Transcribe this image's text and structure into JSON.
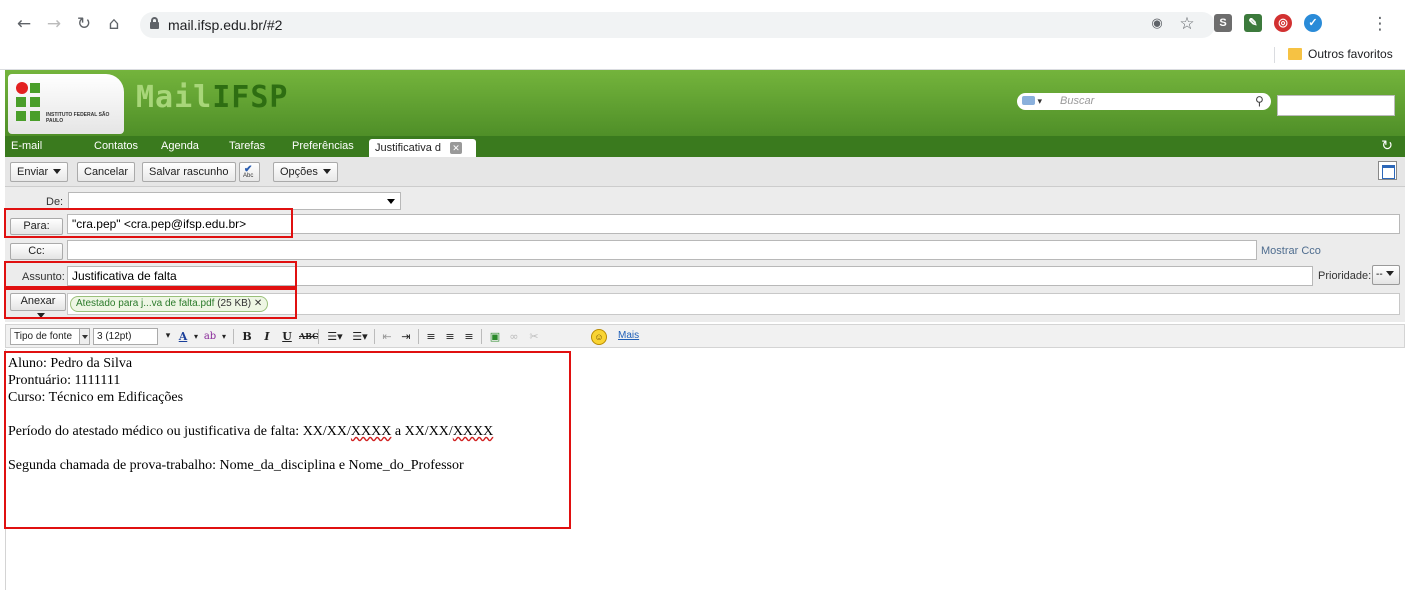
{
  "browser": {
    "url": "mail.ifsp.edu.br/#2",
    "bookmark_folder": "Outros favoritos"
  },
  "header": {
    "brand_prefix": "Mail",
    "brand_suffix": "IFSP",
    "logo_text": "INSTITUTO FEDERAL SÃO PAULO",
    "search_placeholder": "Buscar"
  },
  "app_tabs": {
    "items": [
      "E-mail",
      "Contatos",
      "Agenda",
      "Tarefas",
      "Preferências"
    ],
    "active": "Justificativa d"
  },
  "toolbar": {
    "send": "Enviar",
    "cancel": "Cancelar",
    "save_draft": "Salvar rascunho",
    "spell_check": "Abc",
    "options": "Opções"
  },
  "compose": {
    "from_label": "De:",
    "to_label": "Para:",
    "to_value": "\"cra.pep\" <cra.pep@ifsp.edu.br>",
    "cc_label": "Cc:",
    "show_bcc": "Mostrar Cco",
    "subject_label": "Assunto:",
    "subject_value": "Justificativa de falta",
    "priority_label": "Prioridade:",
    "priority_value": "--",
    "attach_label": "Anexar",
    "attachment_name": "Atestado para j...va de falta.pdf",
    "attachment_size": "(25 KB)"
  },
  "editor_toolbar": {
    "font_family": "Tipo de fonte",
    "font_size": "3 (12pt)",
    "more": "Mais"
  },
  "body": {
    "line1": "Aluno: Pedro da Silva",
    "line2": "Prontuário: 1111111",
    "line3": "Curso: Técnico em Edificações",
    "line4_prefix": "Período do atestado médico ou justificativa de falta: XX/XX/",
    "line4_y1": "XXXX",
    "line4_mid": " a XX/XX/",
    "line4_y2": "XXXX",
    "line5": "Segunda chamada de prova-trabalho: Nome_da_disciplina e Nome_do_Professor"
  },
  "colors": {
    "header_green": "#5fa032",
    "tab_bar_green": "#3a7a1e",
    "highlight_red": "#e01010"
  }
}
